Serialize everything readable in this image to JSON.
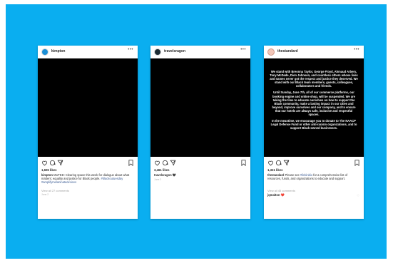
{
  "colors": {
    "background": "#0aaef0",
    "card": "#ffffff",
    "post": "#000000",
    "hashtag": "#3b5c94"
  },
  "posts": [
    {
      "username": "kimpton",
      "likes": "1,606 likes",
      "caption_user": "kimpton",
      "caption_text": "MUTED: Clearing space this week for dialogue about what matters; equality and justice for Black people.",
      "hashtags": "#blackoutuesday #amplifymelaninatedvoices",
      "view_comments": "View all 27 comments",
      "date": "June 2"
    },
    {
      "username": "travelsragon",
      "likes": "3,461 likes",
      "caption_user": "travelsragon",
      "caption_emoji": "🖤",
      "date": "June 2"
    },
    {
      "username": "thestandard",
      "post_paragraphs": [
        "We stand with Breonna Taylor, George Floyd, Ahmaud Arbery, Tony McDade, Dion Johnson, and countless others whose lives and names never got the respect and justice they deserved. We stand with our Black team members, guests, colleagues, collaborators and friends.",
        "Until Sunday, June 7th, all of our commerce platforms, our booking engine and online shop, will be suspended. We are taking the time to educate ourselves on how to support the Black community, make a lasting impact in our cities and beyond, improve ourselves and our company, and to ensure that our hotels are always safe, inclusive and respectful spaces.",
        "In the meantime, we encourage you to donate to The NAACP Legal Defense Fund or other anti-racism organizations, and to support Black-owned businesses."
      ],
      "likes": "1,321 likes",
      "caption_user": "thestandard",
      "caption_text": "Please see",
      "caption_link": "#linkinbio",
      "caption_rest": "for a comprehensive list of resources, funds, and organizations to educate and support.",
      "view_comments": "View all 45 comments",
      "comment_user": "jqmalton",
      "comment_emoji": "❤️"
    }
  ]
}
